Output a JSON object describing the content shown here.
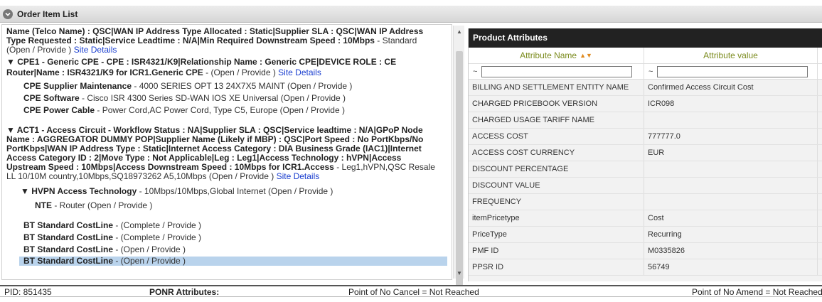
{
  "header": {
    "title": "Order Item List"
  },
  "tree": {
    "lines": [
      {
        "parts": [
          {
            "t": "Name (Telco Name) : QSC|WAN IP Address Type Allocated : Static|Supplier SLA : QSC|WAN IP Address",
            "s": "b"
          }
        ]
      },
      {
        "parts": [
          {
            "t": "Type Requested : Static|Service Leadtime : N/A|Min Required Downstream Speed : 10Mbps",
            "s": "b"
          },
          {
            "t": " - Standard",
            "s": ""
          }
        ]
      },
      {
        "parts": [
          {
            "t": "(Open / Provide )  ",
            "s": ""
          },
          {
            "t": "Site Details",
            "s": "lnk"
          }
        ]
      },
      {
        "parts": [
          {
            "t": "▼ CPE1 - Generic CPE - CPE : ISR4321/K9|Relationship Name : Generic CPE|DEVICE ROLE : CE",
            "s": "b"
          }
        ]
      },
      {
        "parts": [
          {
            "t": "Router|Name : ISR4321/K9 for ICR1.Generic CPE",
            "s": "b"
          },
          {
            "t": " - (Open / Provide )   ",
            "s": ""
          },
          {
            "t": "Site Details",
            "s": "lnk"
          }
        ]
      },
      {
        "parts": [
          {
            "t": "CPE Supplier Maintenance",
            "s": "b"
          },
          {
            "t": " - 4000 SERIES OPT 13 24X7X5 MAINT (Open / Provide )",
            "s": ""
          }
        ]
      },
      {
        "parts": [
          {
            "t": "CPE Software",
            "s": "b"
          },
          {
            "t": " - Cisco ISR 4300 Series SD-WAN IOS XE Universal (Open / Provide )",
            "s": ""
          }
        ]
      },
      {
        "parts": [
          {
            "t": "CPE Power Cable",
            "s": "b"
          },
          {
            "t": " - Power Cord,AC Power Cord, Type C5, Europe (Open / Provide )",
            "s": ""
          }
        ]
      },
      {
        "parts": [
          {
            "t": "▼ ACT1 - Access Circuit - Workflow Status : NA|Supplier SLA : QSC|Service leadtime : N/A|GPoP Node",
            "s": "b"
          }
        ]
      },
      {
        "parts": [
          {
            "t": "Name : AGGREGATOR DUMMY POP|Supplier Name (Likely if MBP) : QSC|Port Speed : No PortKbps/No",
            "s": "b"
          }
        ]
      },
      {
        "parts": [
          {
            "t": "PortKbps|WAN IP Address Type : Static|Internet Access Category : DIA Business Grade (IAC1)|Internet",
            "s": "b"
          }
        ]
      },
      {
        "parts": [
          {
            "t": "Access Category ID : 2|Move Type : Not Applicable|Leg : Leg1|Access Technology : hVPN|Access",
            "s": "b"
          }
        ]
      },
      {
        "parts": [
          {
            "t": "Upstream Speed : 10Mbps|Access Downstream Speed : 10Mbps for ICR1.Access",
            "s": "b"
          },
          {
            "t": " - Leg1,hVPN,QSC Resale",
            "s": ""
          }
        ]
      },
      {
        "parts": [
          {
            "t": "LL 10/10M country,10Mbps,SQ18973262 A5,10Mbps (Open / Provide )   ",
            "s": ""
          },
          {
            "t": "Site Details",
            "s": "lnk"
          }
        ]
      },
      {
        "parts": [
          {
            "t": "▼ HVPN Access Technology",
            "s": "b"
          },
          {
            "t": " - 10Mbps/10Mbps,Global Internet (Open / Provide )",
            "s": ""
          }
        ]
      },
      {
        "parts": [
          {
            "t": "NTE",
            "s": "b"
          },
          {
            "t": " - Router (Open / Provide )",
            "s": ""
          }
        ]
      },
      {
        "parts": [
          {
            "t": "BT Standard CostLine",
            "s": "b"
          },
          {
            "t": " - (Complete / Provide )",
            "s": ""
          }
        ]
      },
      {
        "parts": [
          {
            "t": "BT Standard CostLine",
            "s": "b"
          },
          {
            "t": " - (Complete / Provide )",
            "s": ""
          }
        ]
      },
      {
        "parts": [
          {
            "t": "BT Standard CostLine",
            "s": "b"
          },
          {
            "t": " - (Open / Provide )",
            "s": ""
          }
        ]
      },
      {
        "parts": [
          {
            "t": "BT Standard CostLine",
            "s": "b"
          },
          {
            "t": " - (Open / Provide )",
            "s": ""
          }
        ]
      }
    ]
  },
  "product_attributes": {
    "title": "Product Attributes",
    "col_name": "Attribute Name",
    "col_value": "Attribute value",
    "filter_symbol": "~",
    "rows": [
      {
        "name": "BILLING AND SETTLEMENT ENTITY NAME",
        "value": "Confirmed Access Circuit Cost"
      },
      {
        "name": "CHARGED PRICEBOOK VERSION",
        "value": "ICR098"
      },
      {
        "name": "CHARGED USAGE TARIFF NAME",
        "value": ""
      },
      {
        "name": "ACCESS COST",
        "value": "777777.0"
      },
      {
        "name": "ACCESS COST CURRENCY",
        "value": "EUR"
      },
      {
        "name": "DISCOUNT PERCENTAGE",
        "value": ""
      },
      {
        "name": "DISCOUNT VALUE",
        "value": ""
      },
      {
        "name": "FREQUENCY",
        "value": ""
      },
      {
        "name": "itemPricetype",
        "value": "Cost"
      },
      {
        "name": "PriceType",
        "value": "Recurring"
      },
      {
        "name": "PMF ID",
        "value": "M0335826"
      },
      {
        "name": "PPSR ID",
        "value": "56749"
      }
    ]
  },
  "footer": {
    "pid": "PID: 851435",
    "ponr": "PONR Attributes:",
    "no_cancel": "Point of No Cancel = Not Reached",
    "no_amend": "Point of No Amend = Not Reached"
  }
}
